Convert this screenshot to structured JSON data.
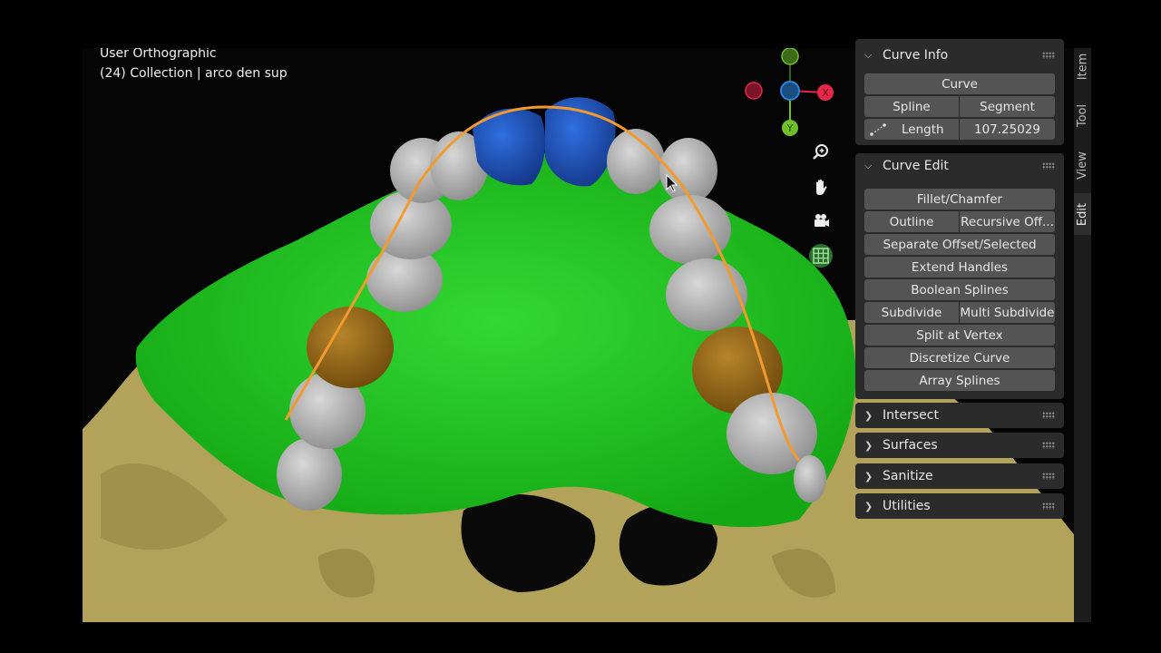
{
  "viewport": {
    "view_name": "User Orthographic",
    "collection_info": "(24) Collection | arco den sup"
  },
  "gizmo": {
    "axis_x": "X",
    "axis_y": "Y",
    "color_x": "#e8264a",
    "color_y": "#6fbf2a",
    "color_z": "#2a86d8"
  },
  "nav_tools": [
    "zoom-icon",
    "hand-pan-icon",
    "camera-icon",
    "grid-ortho-icon"
  ],
  "panels": {
    "curve_info": {
      "title": "Curve Info",
      "curve_label": "Curve",
      "spline_label": "Spline",
      "segment_label": "Segment",
      "length_label": "Length",
      "length_value": "107.25029"
    },
    "curve_edit": {
      "title": "Curve Edit",
      "fillet": "Fillet/Chamfer",
      "outline": "Outline",
      "recursive_offset": "Recursive Off...",
      "separate_offset": "Separate Offset/Selected",
      "extend_handles": "Extend Handles",
      "boolean_splines": "Boolean Splines",
      "subdivide": "Subdivide",
      "multi_subdivide": "Multi Subdivide",
      "split_at_vertex": "Split at Vertex",
      "discretize_curve": "Discretize Curve",
      "array_splines": "Array Splines"
    },
    "intersect": {
      "title": "Intersect"
    },
    "surfaces": {
      "title": "Surfaces"
    },
    "sanitize": {
      "title": "Sanitize"
    },
    "utilities": {
      "title": "Utilities"
    }
  },
  "tabs": {
    "item": "Item",
    "tool": "Tool",
    "view": "View",
    "edit": "Edit"
  },
  "colors": {
    "gum": "#1fc71f",
    "bone": "#b5a55c",
    "tooth": "#b9b9b9",
    "incisor": "#1e4fb0",
    "premolar": "#9a6a15",
    "curve": "#f29a2e",
    "panel_bg": "#2b2b2b",
    "button_bg": "#545454"
  }
}
